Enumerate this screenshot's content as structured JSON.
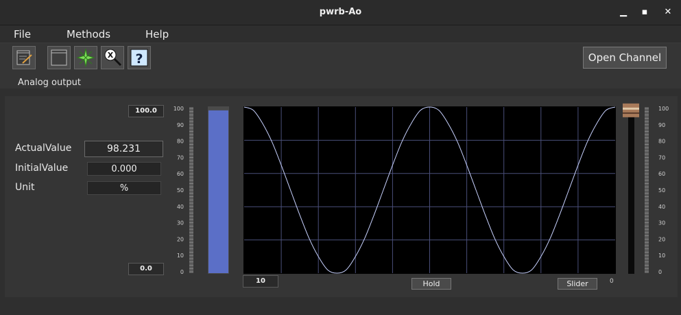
{
  "window": {
    "title": "pwrb-Ao"
  },
  "menu": {
    "file": "File",
    "methods": "Methods",
    "help": "Help"
  },
  "toolbar": {
    "icons": [
      "notepad-icon",
      "window-icon",
      "navigator-icon",
      "crossref-icon",
      "help-icon"
    ],
    "help_glyph": "?",
    "open_channel": "Open Channel",
    "object_description": "Analog output"
  },
  "values": {
    "actual_label": "ActualValue",
    "actual_value": "98.231",
    "initial_label": "InitialValue",
    "initial_value": "0.000",
    "unit_label": "Unit",
    "unit_value": "%"
  },
  "bar": {
    "max_label": "100.0",
    "min_label": "0.0",
    "level": 0.98
  },
  "trend": {
    "time_range": "10",
    "hold_label": "Hold",
    "slider_label": "Slider",
    "slider_min_label": "0",
    "scale_ticks": [
      "100",
      "90",
      "80",
      "70",
      "60",
      "50",
      "40",
      "30",
      "20",
      "10",
      "0"
    ]
  },
  "chart_data": {
    "type": "line",
    "title": "",
    "xlabel": "",
    "ylabel": "",
    "ylim": [
      0,
      100
    ],
    "series": [
      {
        "values": [
          100,
          98,
          90,
          79,
          65,
          50,
          35,
          21,
          10,
          2,
          0,
          2,
          10,
          21,
          35,
          50,
          65,
          79,
          90,
          98,
          100,
          98,
          90,
          79,
          65,
          50,
          35,
          21,
          10,
          2,
          0,
          2,
          10,
          21,
          35,
          50,
          65,
          79,
          90,
          98,
          100
        ]
      }
    ]
  },
  "colors": {
    "bar_fill": "#5b6fc7",
    "trend_line": "#c8d2ff",
    "grid": "#4a4f7a"
  }
}
